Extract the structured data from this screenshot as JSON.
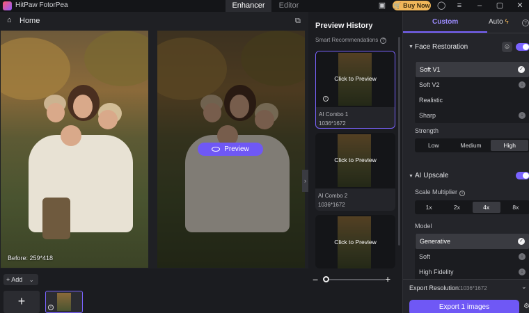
{
  "app": {
    "title": "HitPaw FotorPea"
  },
  "tabs": {
    "enhancer": "Enhancer",
    "editor": "Editor"
  },
  "topbar": {
    "buy_now": "Buy Now",
    "icons": [
      "window-icon",
      "cart-icon",
      "user-icon",
      "menu-icon",
      "minimize-icon",
      "maximize-icon",
      "close-icon"
    ]
  },
  "home": {
    "label": "Home"
  },
  "canvas": {
    "before_label": "Before: 259*418",
    "preview_label": "Preview"
  },
  "bottom": {
    "add_label": "Add",
    "zoom_minus": "−",
    "zoom_plus": "+",
    "zoom_level": 0.0
  },
  "history": {
    "title": "Preview History",
    "smart_recommendations": "Smart Recommendations",
    "cards": [
      {
        "cta": "Click to Preview",
        "name": "AI Combo 1",
        "size": "1036*1672"
      },
      {
        "cta": "Click to Preview",
        "name": "AI Combo 2",
        "size": "1036*1672"
      },
      {
        "cta": "Click to Preview",
        "name": "",
        "size": ""
      }
    ]
  },
  "panel": {
    "tab_custom": "Custom",
    "tab_auto": "Auto",
    "face_restoration": {
      "title": "Face Restoration",
      "options": [
        "Soft V1",
        "Soft V2",
        "Realistic",
        "Sharp"
      ],
      "strength_label": "Strength",
      "strength_options": [
        "Low",
        "Medium",
        "High"
      ]
    },
    "ai_upscale": {
      "title": "AI Upscale",
      "scale_label": "Scale Multiplier",
      "scale_options": [
        "1x",
        "2x",
        "4x",
        "8x"
      ],
      "model_label": "Model",
      "model_options": [
        "Generative",
        "Soft",
        "High Fidelity"
      ]
    },
    "export_resolution_label": "Export Resolution:",
    "export_resolution_value": "1036*1672",
    "export_button": "Export 1 images"
  },
  "colors": {
    "accent": "#7a63ff",
    "button": "#6f58f5",
    "buy_now": "#f0b75a"
  }
}
